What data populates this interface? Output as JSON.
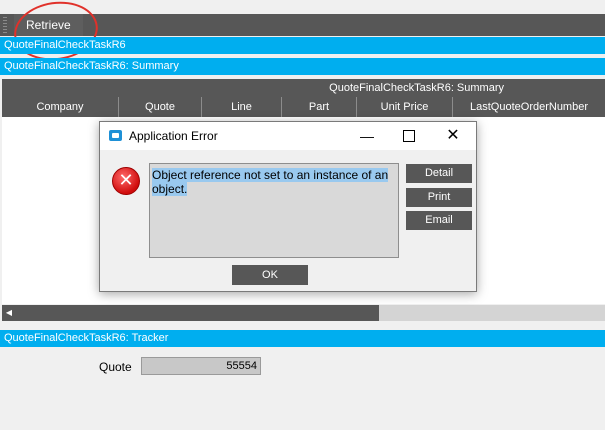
{
  "toolbar": {
    "retrieve_label": "Retrieve"
  },
  "panels": {
    "task_title": "QuoteFinalCheckTaskR6",
    "summary_title": "QuoteFinalCheckTaskR6: Summary",
    "tracker_title": "QuoteFinalCheckTaskR6: Tracker"
  },
  "grid": {
    "title": "QuoteFinalCheckTaskR6: Summary",
    "columns": [
      "Company",
      "Quote",
      "Line",
      "Part",
      "Unit Price",
      "LastQuoteOrderNumber"
    ]
  },
  "tracker": {
    "quote_label": "Quote",
    "quote_value": "55554"
  },
  "dialog": {
    "title": "Application Error",
    "minimize_glyph": "—",
    "close_glyph": "✕",
    "message": "Object reference not set to an instance of an object.",
    "buttons": {
      "detail": "Detail",
      "print": "Print",
      "email": "Email",
      "ok": "OK"
    }
  },
  "colors": {
    "accent_blue": "#00aeef",
    "dark_gray": "#575757",
    "annotation_red": "#e0312a"
  },
  "icons": {
    "error": "error-x-icon",
    "app": "app-window-icon"
  }
}
